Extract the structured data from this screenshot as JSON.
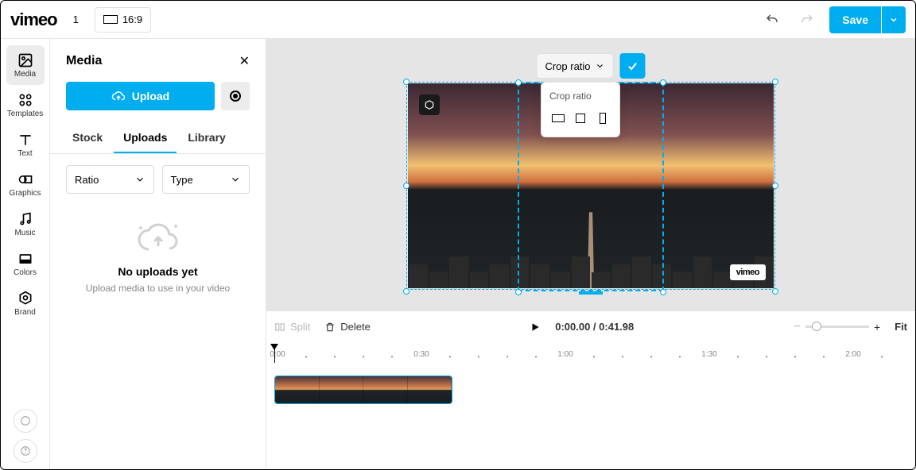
{
  "header": {
    "logo": "vimeo",
    "page_number": "1",
    "aspect_label": "16:9",
    "save_label": "Save"
  },
  "rail": [
    {
      "label": "Media",
      "active": true
    },
    {
      "label": "Templates"
    },
    {
      "label": "Text"
    },
    {
      "label": "Graphics"
    },
    {
      "label": "Music"
    },
    {
      "label": "Colors"
    },
    {
      "label": "Brand"
    }
  ],
  "panel": {
    "title": "Media",
    "upload_label": "Upload",
    "tabs": [
      "Stock",
      "Uploads",
      "Library"
    ],
    "active_tab": "Uploads",
    "select_ratio": "Ratio",
    "select_type": "Type",
    "empty_title": "No uploads yet",
    "empty_sub": "Upload media to use in your video"
  },
  "crop": {
    "chip_label": "Crop ratio",
    "popover_title": "Crop ratio"
  },
  "preview": {
    "watermark": "vimeo"
  },
  "toolrow": {
    "split": "Split",
    "delete": "Delete",
    "time_current": "0:00.00",
    "time_total": "0:41.98",
    "fit": "Fit"
  },
  "ruler": {
    "major": [
      "0:00",
      "0:30",
      "1:00",
      "1:30",
      "2:00"
    ]
  }
}
